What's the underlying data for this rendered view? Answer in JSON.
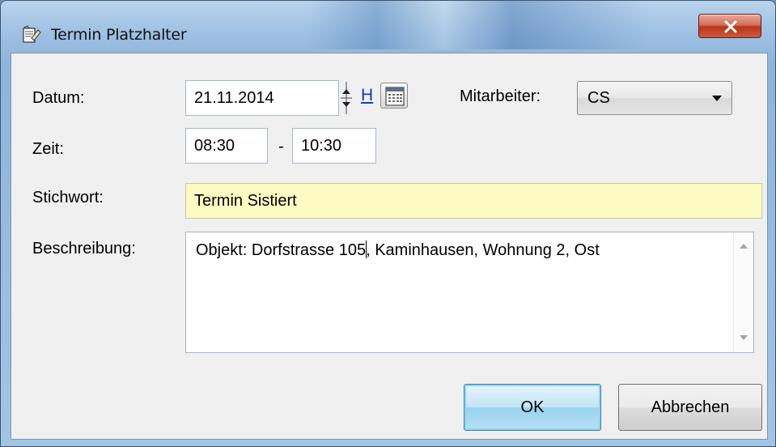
{
  "window": {
    "title": "Termin Platzhalter",
    "close_label": "x"
  },
  "form": {
    "datum_label": "Datum:",
    "datum_value": "21.11.2014",
    "h_link": "H",
    "mitarbeiter_label": "Mitarbeiter:",
    "mitarbeiter_value": "CS",
    "zeit_label": "Zeit:",
    "zeit_from": "08:30",
    "zeit_sep": "-",
    "zeit_to": "10:30",
    "stichwort_label": "Stichwort:",
    "stichwort_value": "Termin Sistiert",
    "beschreibung_label": "Beschreibung:",
    "beschreibung_before_cursor": "Objekt: Dorfstrasse 105",
    "beschreibung_after_cursor": ", Kaminhausen, Wohnung 2, Ost"
  },
  "buttons": {
    "ok": "OK",
    "cancel": "Abbrechen"
  },
  "colors": {
    "stichwort_bg": "#fdfbc2",
    "link": "#0a3ac9",
    "close_red": "#c7432a",
    "ok_blue": "#98d1ef"
  },
  "icons": {
    "app": "notepad-hand-icon",
    "spinner": "spin-up-down-icon",
    "calendar": "calendar-icon",
    "dropdown": "chevron-down-icon",
    "close": "close-icon"
  }
}
